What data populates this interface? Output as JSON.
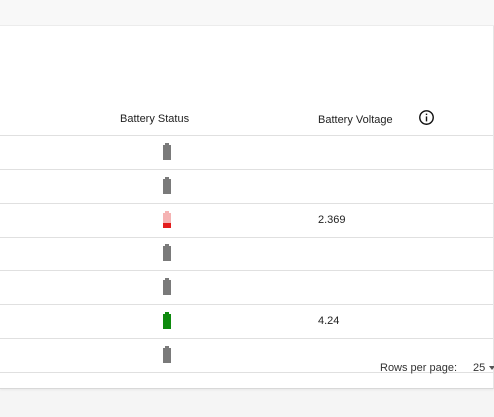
{
  "table": {
    "columns": {
      "battery_status": "Battery Status",
      "battery_voltage": "Battery Voltage"
    },
    "info_icon": "info-circle-icon",
    "rows": [
      {
        "status": "unknown",
        "voltage": ""
      },
      {
        "status": "unknown",
        "voltage": ""
      },
      {
        "status": "low",
        "voltage": "2.369"
      },
      {
        "status": "unknown",
        "voltage": ""
      },
      {
        "status": "unknown",
        "voltage": ""
      },
      {
        "status": "full",
        "voltage": "4.24"
      },
      {
        "status": "unknown",
        "voltage": ""
      }
    ]
  },
  "pagination": {
    "rows_per_page_label": "Rows per page:",
    "rows_per_page_value": "25"
  },
  "colors": {
    "battery_unknown": "#7a7a7a",
    "battery_low_fill": "#e31b1b",
    "battery_low_empty": "#f5b3b3",
    "battery_full": "#0e8a0e"
  }
}
